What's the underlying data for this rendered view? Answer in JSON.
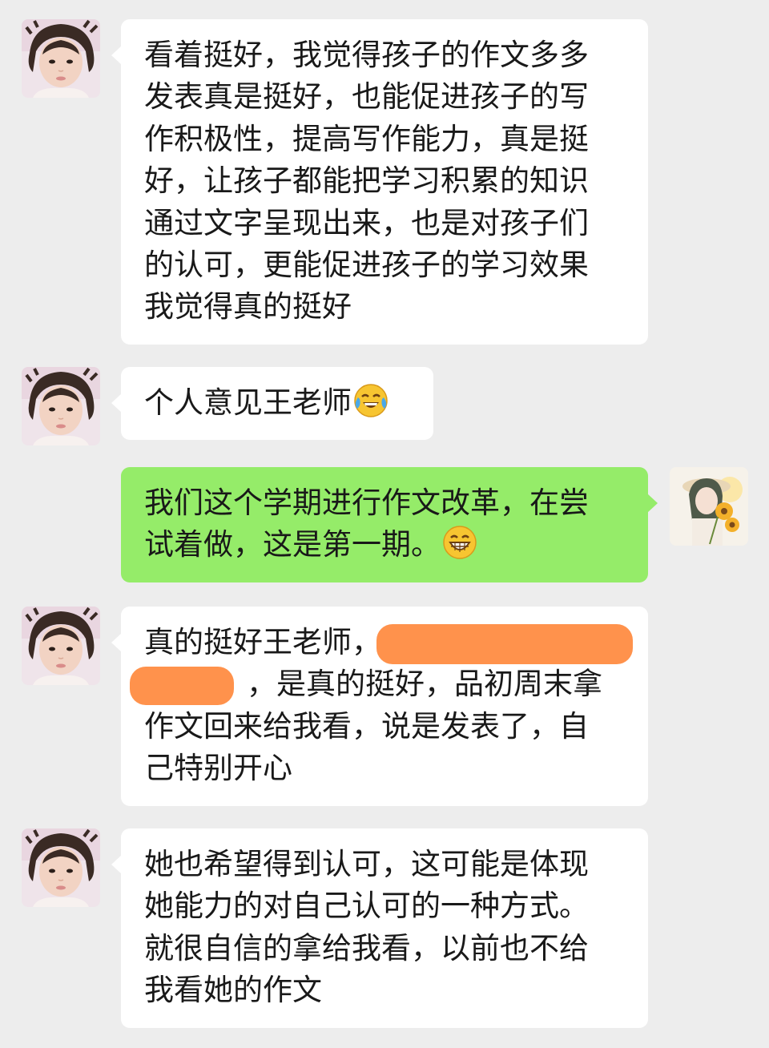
{
  "messages": [
    {
      "sender": "other",
      "lines": [
        "看着挺好，我觉得孩子的作文多多",
        "发表真是挺好，也能促进孩子的写",
        "作积极性，提高写作能力，真是挺",
        "好，让孩子都能把学习积累的知识",
        "通过文字呈现出来，也是对孩子们",
        "的认可，更能促进孩子的学习效果",
        "我觉得真的挺好"
      ]
    },
    {
      "sender": "other",
      "text": "个人意见王老师",
      "emoji": "laugh-crying-emoji"
    },
    {
      "sender": "self",
      "line1": "我们这个学期进行作文改革，在尝",
      "line2": "试着做，这是第一期。",
      "emoji": "grin-emoji"
    },
    {
      "sender": "other",
      "lines": [
        "真的挺好王老师，",
        "，是真的挺好，品初周末拿",
        "作文回来给我看，说是发表了，自",
        "己特别开心"
      ],
      "redaction_color": "#ff8c42"
    },
    {
      "sender": "other",
      "lines": [
        "她也希望得到认可，这可能是体现",
        "她能力的对自己认可的一种方式。",
        "就很自信的拿给我看，以前也不给",
        "我看她的作文"
      ]
    }
  ],
  "theme": {
    "background": "#ededed",
    "incoming_bubble": "#ffffff",
    "outgoing_bubble": "#95ec69",
    "text": "#191919"
  }
}
